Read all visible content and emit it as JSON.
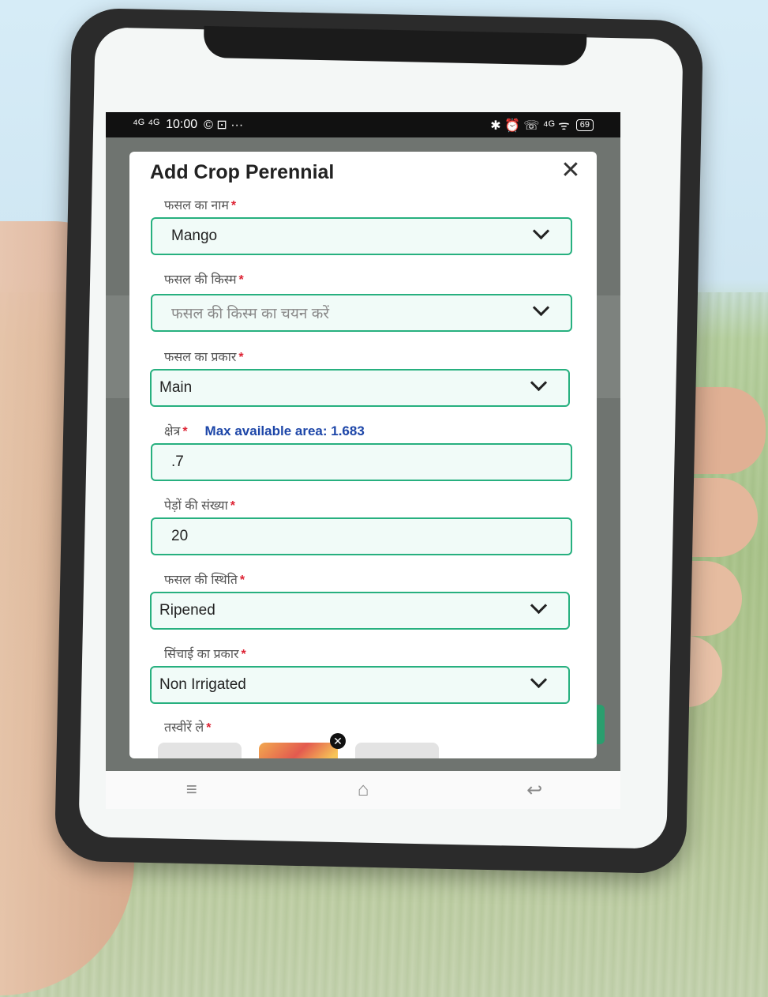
{
  "status_bar": {
    "signal": "⁴ᴳ ⁴ᴳ",
    "time": "10:00",
    "notif_icons": "© ⊡ ···",
    "right_icons": "✱ ⏰ ☏ ⁴ᴳ ᯤ",
    "battery": "69"
  },
  "modal": {
    "title": "Add Crop Perennial",
    "close": "✕",
    "crop_name": {
      "label": "फसल का नाम",
      "value": "Mango"
    },
    "crop_variety": {
      "label": "फसल की किस्म",
      "placeholder": "फसल की किस्म का चयन करें"
    },
    "crop_type": {
      "label": "फसल का प्रकार",
      "value": "Main"
    },
    "area": {
      "label": "क्षेत्र",
      "max_note": "Max available area: 1.683",
      "value": ".7"
    },
    "tree_count": {
      "label": "पेड़ों की संख्या",
      "value": "20"
    },
    "crop_status": {
      "label": "फसल की स्थिति",
      "value": "Ripened"
    },
    "irrigation_type": {
      "label": "सिंचाई का प्रकार",
      "value": "Non Irrigated"
    },
    "photos": {
      "label": "तस्वीरें ले",
      "remove": "✕"
    },
    "required_mark": "*"
  },
  "nav": {
    "menu": "≡",
    "home": "⌂",
    "back": "↩"
  }
}
